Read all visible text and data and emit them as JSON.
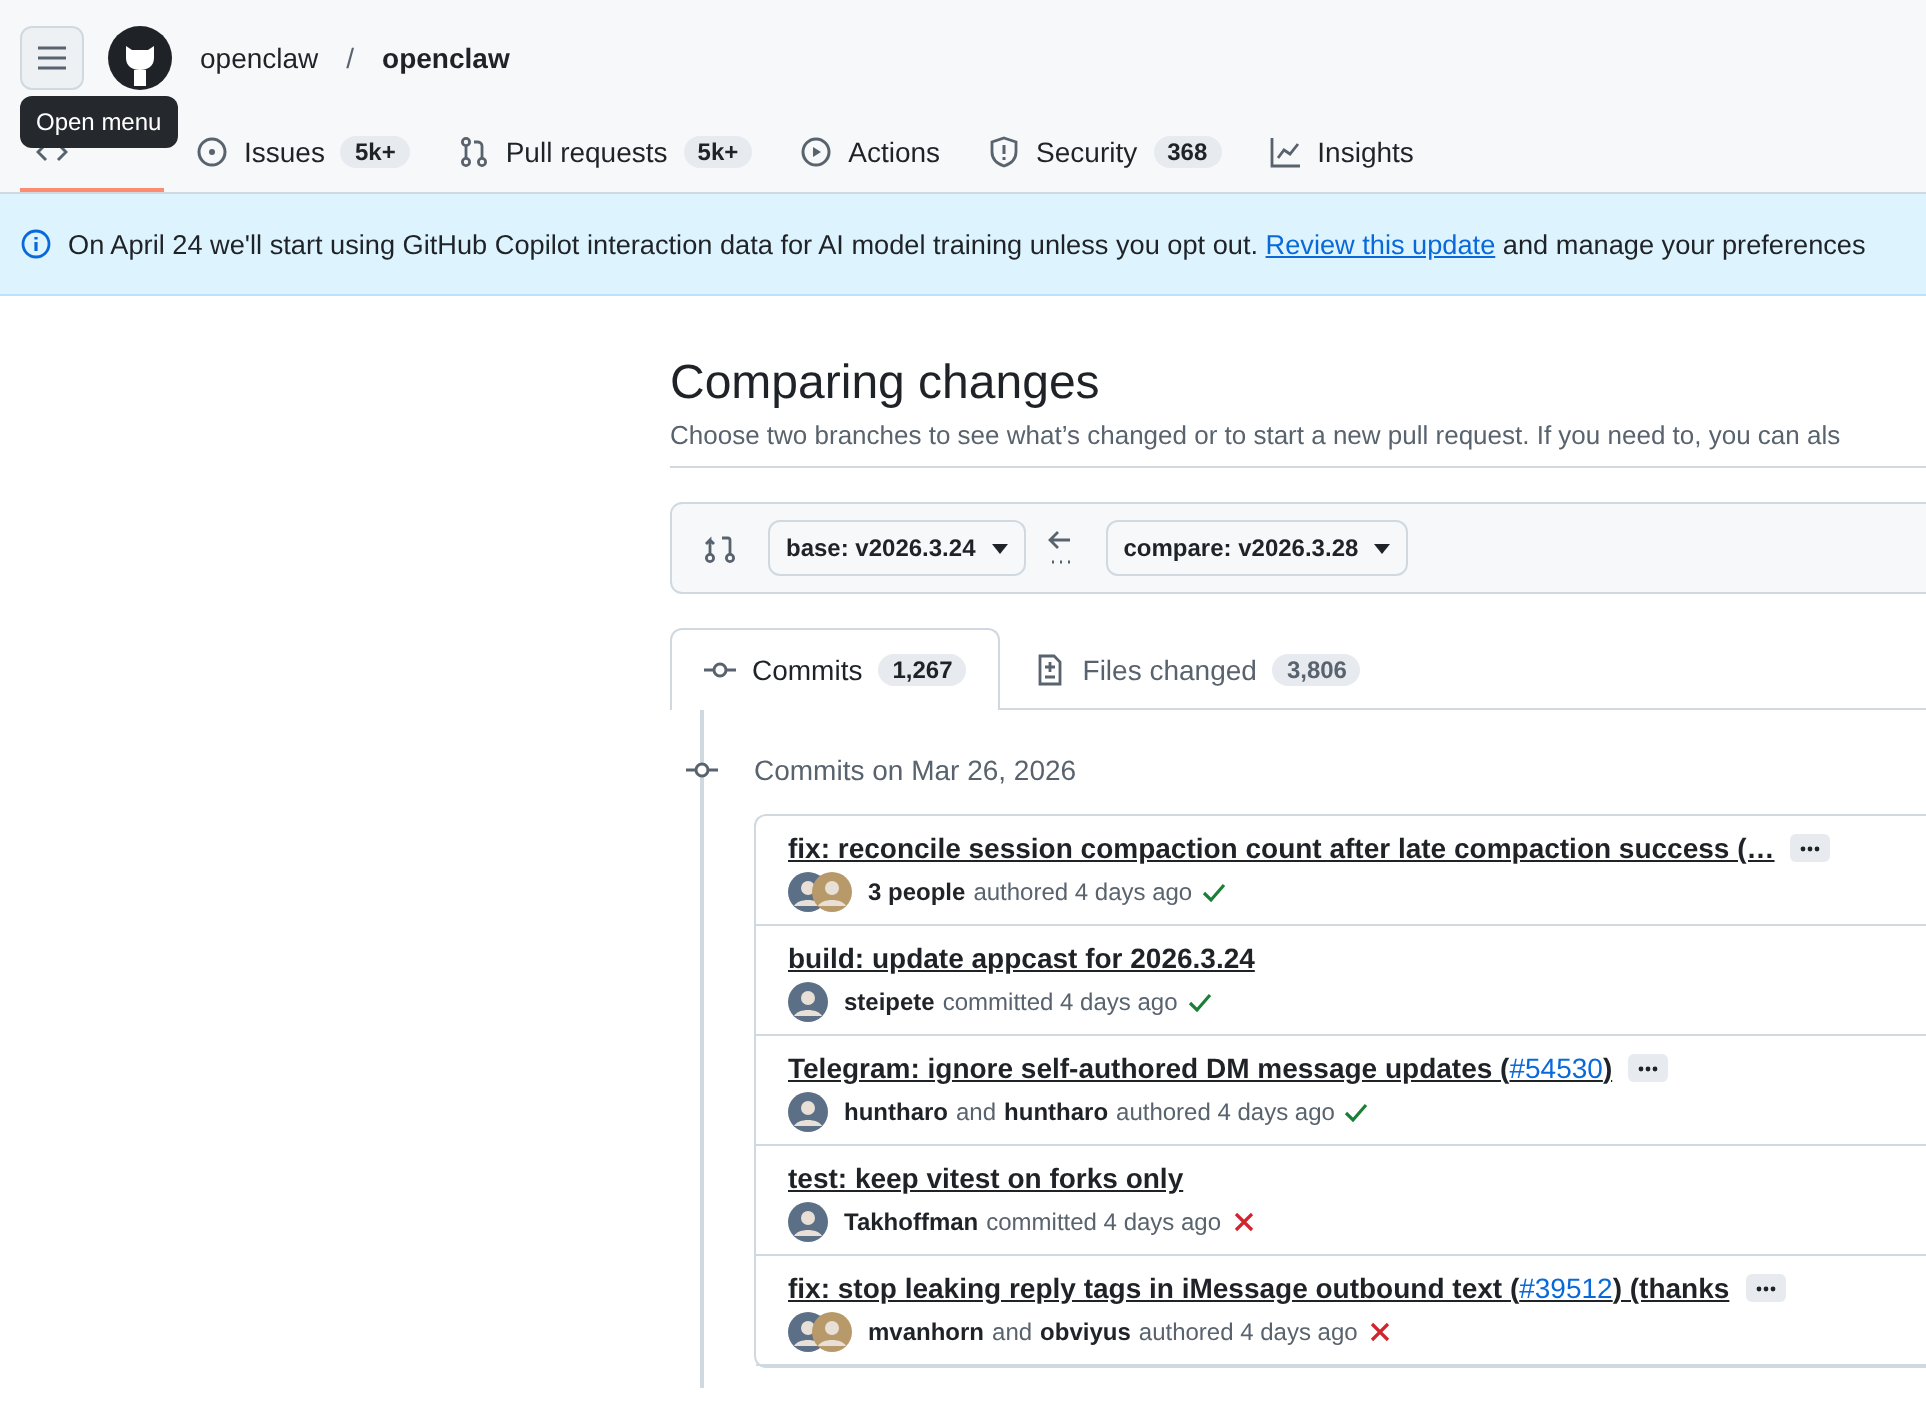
{
  "header": {
    "menu_tooltip": "Open menu",
    "owner": "openclaw",
    "separator": "/",
    "repo": "openclaw"
  },
  "tabs": [
    {
      "selected": true
    },
    {
      "label": "Issues",
      "count": "5k+",
      "selected": false
    },
    {
      "label": "Pull requests",
      "count": "5k+",
      "selected": false
    },
    {
      "label": "Actions",
      "selected": false
    },
    {
      "label": "Security",
      "count": "368",
      "selected": false
    },
    {
      "label": "Insights",
      "selected": false
    }
  ],
  "banner": {
    "text": "On April 24 we'll start using GitHub Copilot interaction data for AI model training unless you opt out.",
    "link": "Review this update",
    "tail": "and manage your preferences"
  },
  "compare": {
    "title": "Comparing changes",
    "subtitle": "Choose two branches to see what’s changed or to start a new pull request. If you need to, you can als",
    "base": "base: v2026.3.24",
    "head": "compare: v2026.3.28"
  },
  "result_tabs": [
    {
      "label": "Commits",
      "count": "1,267",
      "selected": true
    },
    {
      "label": "Files changed",
      "count": "3,806",
      "selected": false
    }
  ],
  "commit_group": {
    "heading": "Commits on Mar 26, 2026"
  },
  "commits": [
    {
      "title": "fix: reconcile session compaction count after late compaction success (…",
      "kind": "stack",
      "authors": [
        "3 people"
      ],
      "verb": "authored",
      "time": "4 days ago",
      "passed": true,
      "more": true
    },
    {
      "title": "build: update appcast for 2026.3.24",
      "kind": "single",
      "authors": [
        "steipete"
      ],
      "verb": "committed",
      "time": "4 days ago",
      "passed": true,
      "more": false
    },
    {
      "title": "Telegram: ignore self-authored DM message updates (",
      "pr": "#54530",
      "tail": ")",
      "kind": "single",
      "authors": [
        "huntharo",
        "huntharo"
      ],
      "joiner": "and",
      "verb": "authored",
      "time": "4 days ago",
      "passed": true,
      "more": true
    },
    {
      "title": "test: keep vitest on forks only",
      "kind": "single",
      "authors": [
        "Takhoffman"
      ],
      "verb": "committed",
      "time": "4 days ago",
      "passed": false,
      "more": false
    },
    {
      "title": "fix: stop leaking reply tags in iMessage outbound text (",
      "pr": "#39512",
      "tail": ") (thanks",
      "kind": "stack",
      "authors": [
        "mvanhorn",
        "obviyus"
      ],
      "joiner": "and",
      "verb": "authored",
      "time": "4 days ago",
      "passed": false,
      "more": true
    }
  ]
}
